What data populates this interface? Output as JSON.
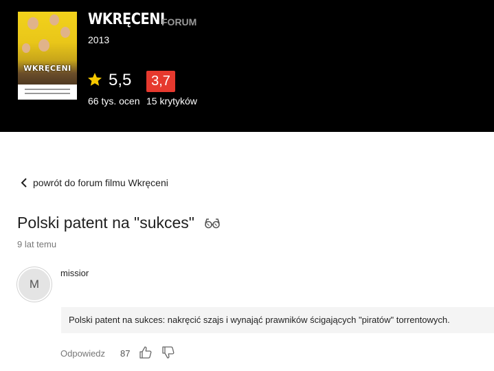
{
  "movie": {
    "title": "Wkręceni",
    "section_label": "FORUM",
    "year": "2013",
    "rating": "5,5",
    "rating_count": "66 tys. ocen",
    "critic_rating": "3,7",
    "critic_count": "15 krytyków",
    "poster_title": "WKRĘCENI"
  },
  "colors": {
    "header_bg": "#000000",
    "star": "#f6c800",
    "critic_badge": "#e6392e"
  },
  "nav": {
    "back_label": "powrót do forum filmu Wkręceni"
  },
  "topic": {
    "title": "Polski patent na \"sukces\"",
    "time_ago": "9 lat temu"
  },
  "post": {
    "avatar_initial": "M",
    "username": "missior",
    "body": "Polski patent na sukces: nakręcić szajs i wynająć prawników ścigających \"piratów\" torrentowych.",
    "reply_label": "Odpowiedz",
    "votes": "87"
  },
  "icons": {
    "back": "chevron-left-icon",
    "star": "star-icon",
    "spoiler": "glasses-icon",
    "like": "thumbs-up-icon",
    "dislike": "thumbs-down-icon"
  }
}
